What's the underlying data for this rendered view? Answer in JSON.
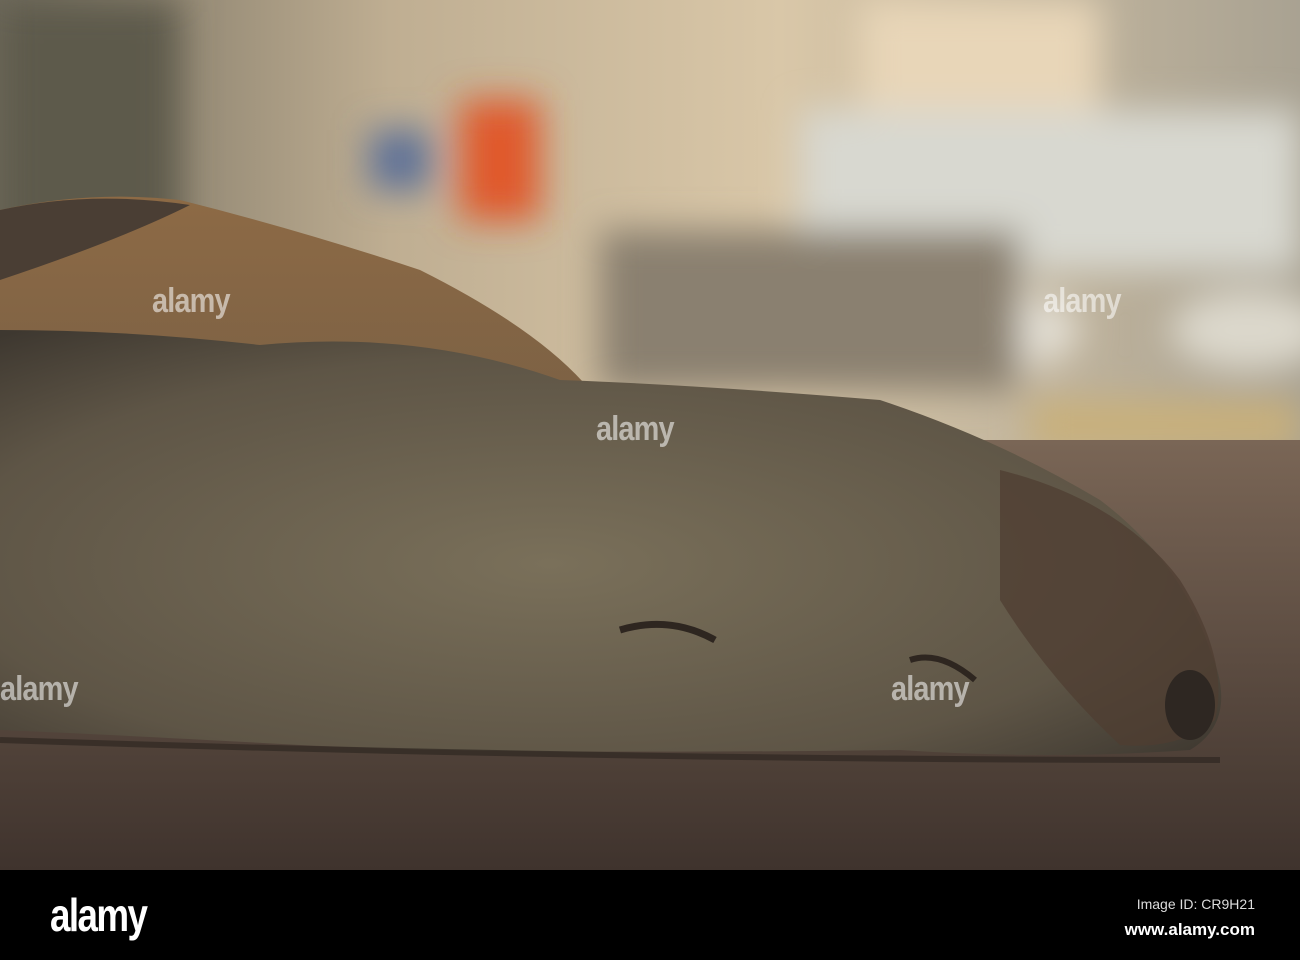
{
  "watermark": "alamy",
  "footer": {
    "logo": "alamy",
    "image_id": "Image ID: CR9H21",
    "website": "www.alamy.com"
  },
  "colors": {
    "deck": "#4e4038",
    "fur": "#6e6450",
    "background": "#b9ab92"
  }
}
